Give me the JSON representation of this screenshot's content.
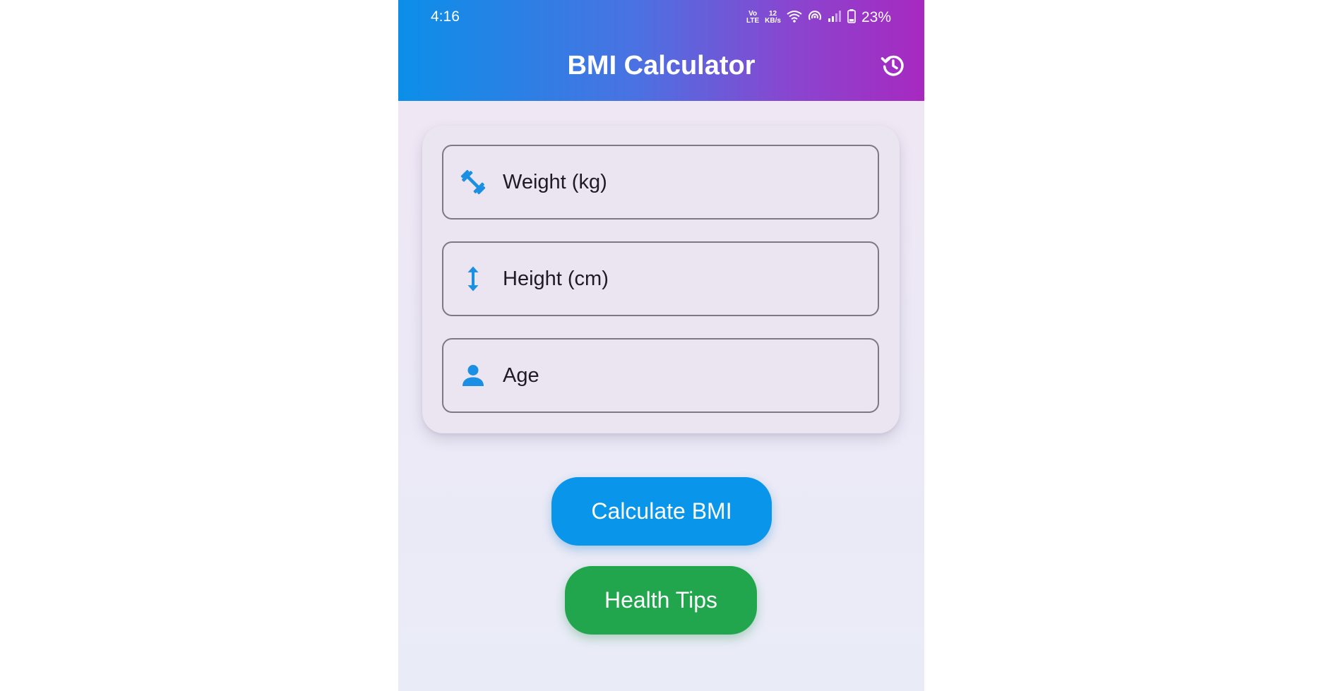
{
  "status_bar": {
    "time": "4:16",
    "volte_top": "Vo",
    "volte_bottom": "LTE",
    "speed_value": "12",
    "speed_unit": "KB/s",
    "battery_percent": "23%"
  },
  "app_bar": {
    "title": "BMI Calculator",
    "history_icon": "history-icon"
  },
  "form": {
    "fields": [
      {
        "label": "Weight (kg)",
        "icon": "fitness-icon"
      },
      {
        "label": "Height (cm)",
        "icon": "height-icon"
      },
      {
        "label": "Age",
        "icon": "person-icon"
      }
    ]
  },
  "actions": {
    "calculate_label": "Calculate BMI",
    "tips_label": "Health Tips"
  },
  "colors": {
    "gradient_start": "#0b8fe8",
    "gradient_end": "#a729c0",
    "primary_blue": "#0996ea",
    "success_green": "#22a64d",
    "icon_blue": "#1a8fe3"
  }
}
